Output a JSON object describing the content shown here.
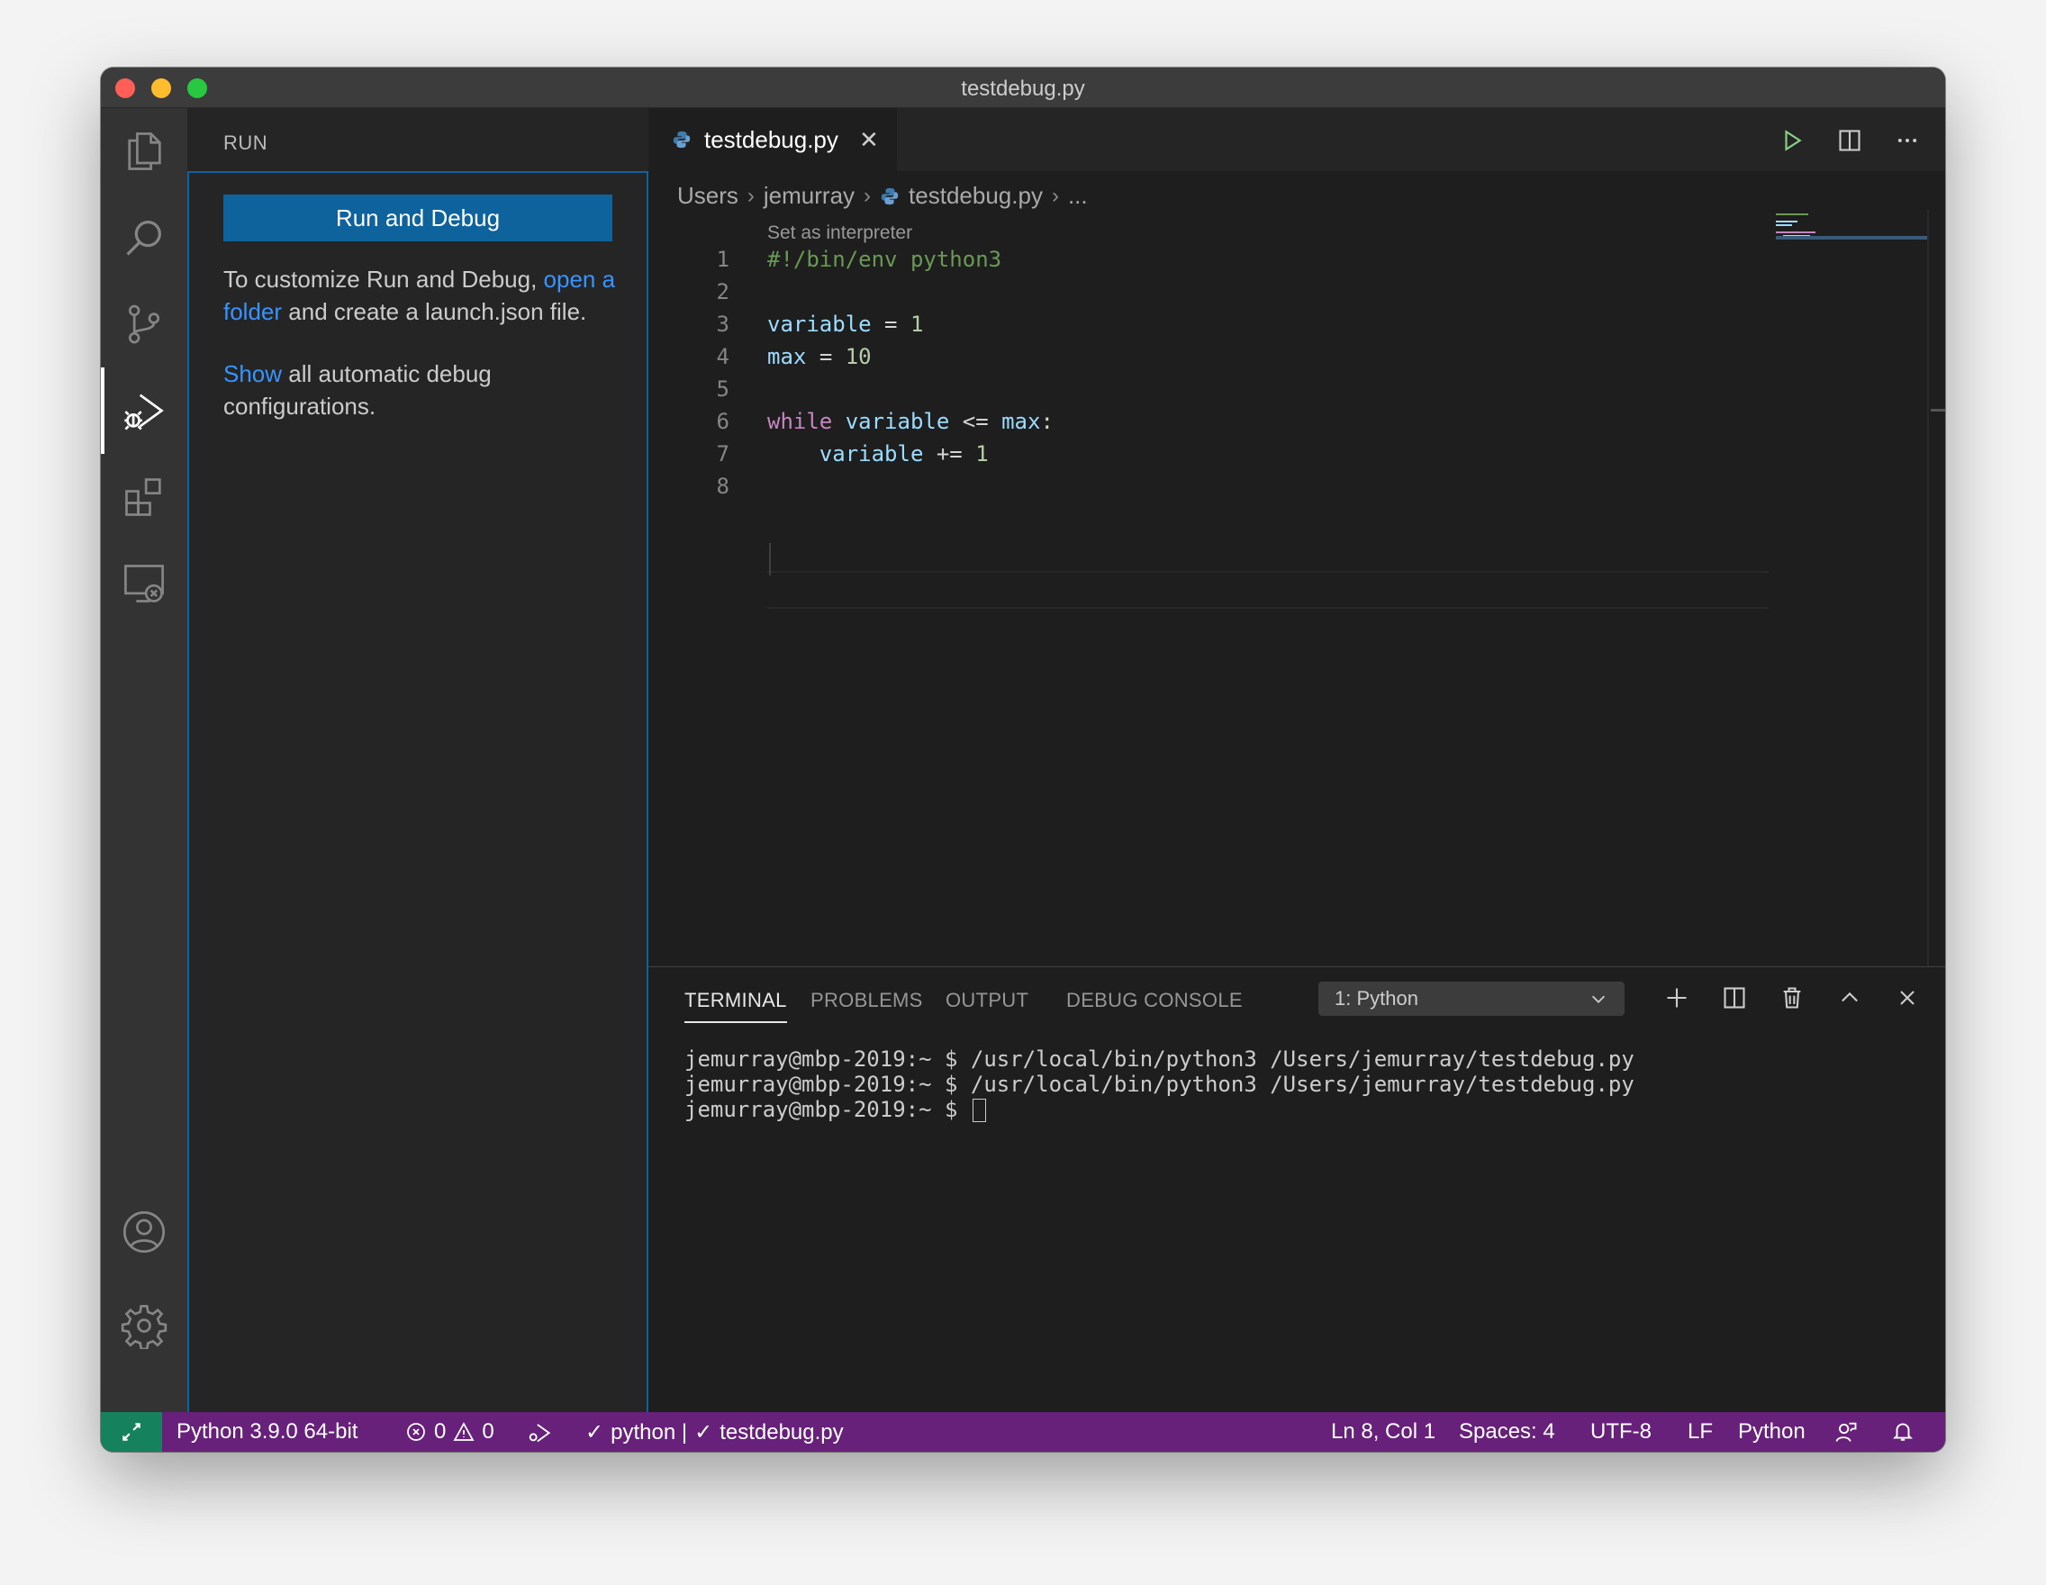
{
  "window": {
    "title": "testdebug.py"
  },
  "sidebar": {
    "header": "RUN",
    "run_button": "Run and Debug",
    "text1_a": "To customize Run and Debug, ",
    "text1_link": "open a folder",
    "text1_b": " and create a launch.json file.",
    "text2_link": "Show",
    "text2_b": " all automatic debug configurations."
  },
  "editor": {
    "tab": {
      "label": "testdebug.py"
    },
    "breadcrumb": [
      "Users",
      "jemurray",
      "testdebug.py",
      "..."
    ],
    "codelens": "Set as interpreter",
    "lines": [
      {
        "n": "1",
        "text": "#!/bin/env python3"
      },
      {
        "n": "2",
        "text": ""
      },
      {
        "n": "3",
        "text": "variable = 1"
      },
      {
        "n": "4",
        "text": "max = 10"
      },
      {
        "n": "5",
        "text": ""
      },
      {
        "n": "6",
        "text": "while variable <= max:"
      },
      {
        "n": "7",
        "text": "    variable += 1"
      },
      {
        "n": "8",
        "text": ""
      }
    ]
  },
  "panel": {
    "tabs": [
      "TERMINAL",
      "PROBLEMS",
      "OUTPUT",
      "DEBUG CONSOLE"
    ],
    "active_tab": "TERMINAL",
    "terminal_select": "1: Python",
    "terminal_lines": [
      "jemurray@mbp-2019:~ $ /usr/local/bin/python3 /Users/jemurray/testdebug.py",
      "jemurray@mbp-2019:~ $ /usr/local/bin/python3 /Users/jemurray/testdebug.py",
      "jemurray@mbp-2019:~ $ "
    ]
  },
  "statusbar": {
    "interpreter": "Python 3.9.0 64-bit",
    "errors": "0",
    "warnings": "0",
    "python_check": "python |",
    "file_check": "testdebug.py",
    "position": "Ln 8, Col 1",
    "spaces": "Spaces: 4",
    "encoding": "UTF-8",
    "eol": "LF",
    "language": "Python"
  },
  "colors": {
    "statusbar": "#68217a",
    "remote": "#16825d",
    "accent": "#0e639c",
    "link": "#3794ff"
  }
}
